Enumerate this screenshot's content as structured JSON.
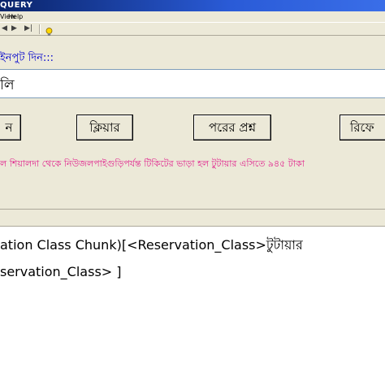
{
  "window": {
    "title": "QUERY"
  },
  "menu": {
    "items": [
      "View",
      "Help"
    ]
  },
  "toolbar": {
    "icons": [
      "prev-icon",
      "next-icon",
      "last-icon",
      "help-bulb-icon"
    ],
    "glyphs": {
      "prev": "◀",
      "next": "▶",
      "last": "▶|"
    }
  },
  "prompt": {
    "label": "ইনপুট দিন:::"
  },
  "input": {
    "value": "লি"
  },
  "buttons": {
    "submit_label": "ন",
    "clear_label": "ক্লিয়ার",
    "next_question_label": "পরের প্রশ্ন",
    "refresh_label": "রিফে"
  },
  "result": {
    "text": "ল   শিয়ালদা থেকে নিউজলপাইগুড়িপর্যন্ত টিকিটের ভাড়া হল  টুটায়ার এসিতে ৯৪৫ টাকা"
  },
  "output": {
    "line1": "ation Class Chunk)[<Reservation_Class>টুটায়ার",
    "line2": "servation_Class> ]"
  },
  "colors": {
    "titlebar": "#0a246a",
    "prompt_text": "#0000cc",
    "result_text": "#e0208c",
    "window_bg": "#ece9d8"
  }
}
